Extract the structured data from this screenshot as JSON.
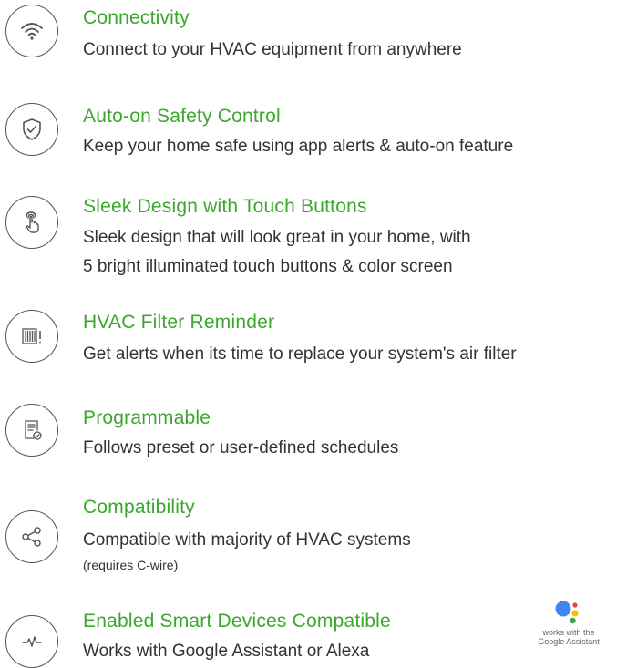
{
  "features": [
    {
      "title": "Connectivity",
      "desc": [
        "Connect to your HVAC equipment from anywhere"
      ],
      "icon": "wifi-icon"
    },
    {
      "title": "Auto-on Safety Control",
      "desc": [
        "Keep your home safe using app alerts & auto-on feature"
      ],
      "icon": "shield-check-icon"
    },
    {
      "title": "Sleek Design with Touch Buttons",
      "desc": [
        "Sleek design that will look great in your home, with",
        "5 bright illuminated touch buttons & color screen"
      ],
      "icon": "touch-finger-icon"
    },
    {
      "title": "HVAC Filter Reminder",
      "desc": [
        "Get alerts when its time to replace your system's air filter"
      ],
      "icon": "filter-alert-icon"
    },
    {
      "title": "Programmable",
      "desc": [
        "Follows preset or user-defined schedules"
      ],
      "icon": "schedule-document-icon"
    },
    {
      "title": "Compatibility",
      "desc": [
        "Compatible with majority of HVAC systems"
      ],
      "note": "(requires C-wire)",
      "icon": "share-nodes-icon"
    },
    {
      "title": "Enabled Smart Devices Compatible",
      "desc": [
        "Works with Google Assistant or Alexa"
      ],
      "icon": "pulse-icon"
    }
  ],
  "google_assistant": {
    "line1": "works with the",
    "line2": "Google Assistant"
  },
  "colors": {
    "accent": "#3ba72c",
    "text": "#333333",
    "icon_stroke": "#555555"
  }
}
